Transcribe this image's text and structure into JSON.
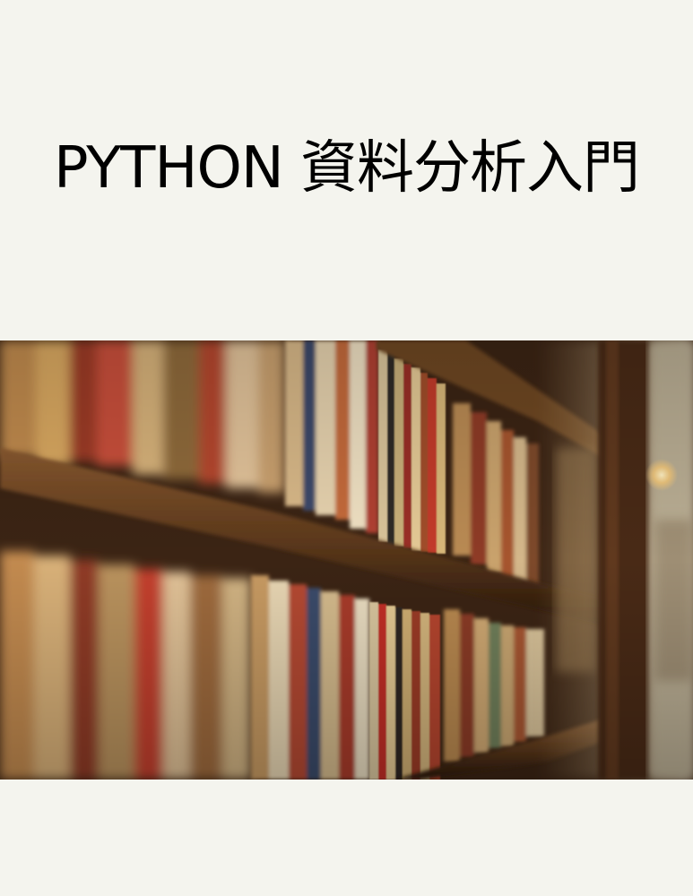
{
  "cover": {
    "title": "PYTHON 資料分析入門"
  },
  "photo": {
    "subject": "library-bookshelf",
    "colors": {
      "wood": "#6b4222",
      "wood_dark": "#2b1a0e",
      "warm_light": "#f2c77a",
      "page_background": "#f4f4ee"
    }
  }
}
